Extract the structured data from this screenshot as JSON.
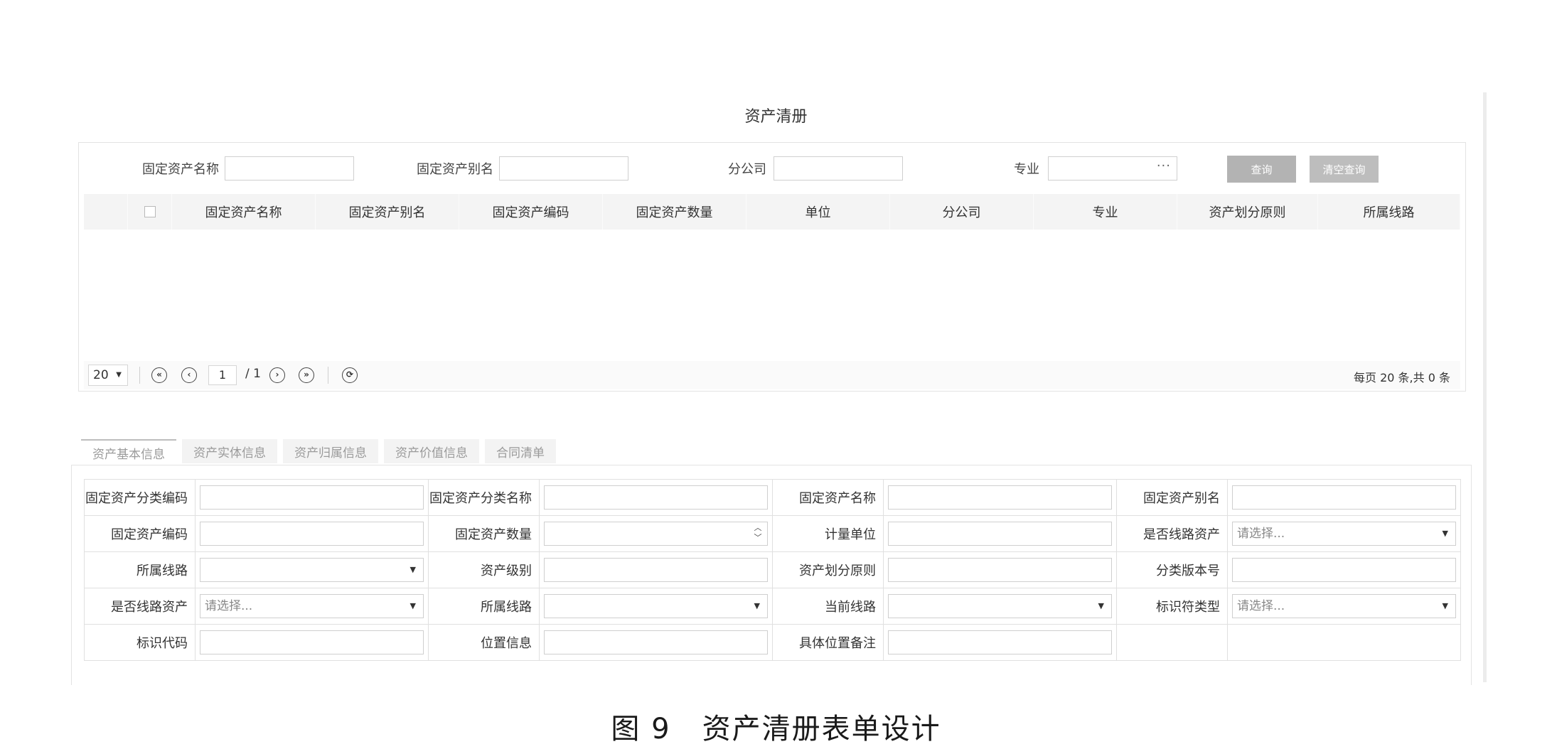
{
  "page": {
    "title": "资产清册"
  },
  "query": {
    "fields": [
      {
        "label": "固定资产名称",
        "value": ""
      },
      {
        "label": "固定资产别名",
        "value": ""
      },
      {
        "label": "分公司",
        "value": ""
      },
      {
        "label": "专业",
        "value": "",
        "ellipsis": "···"
      }
    ],
    "query_button": "查询",
    "clear_button": "清空查询"
  },
  "grid": {
    "columns": [
      "固定资产名称",
      "固定资产别名",
      "固定资产编码",
      "固定资产数量",
      "单位",
      "分公司",
      "专业",
      "资产划分原则",
      "所属线路"
    ],
    "rows": []
  },
  "pager": {
    "page_size": "20",
    "current_page": "1",
    "total_pages": "/ 1",
    "summary": "每页 20 条,共 0 条"
  },
  "tabs": [
    "资产基本信息",
    "资产实体信息",
    "资产归属信息",
    "资产价值信息",
    "合同清单"
  ],
  "form": {
    "rows": [
      [
        {
          "label": "固定资产分类编码",
          "type": "text",
          "value": ""
        },
        {
          "label": "固定资产分类名称",
          "type": "text",
          "value": ""
        },
        {
          "label": "固定资产名称",
          "type": "text",
          "value": ""
        },
        {
          "label": "固定资产别名",
          "type": "text",
          "value": ""
        }
      ],
      [
        {
          "label": "固定资产编码",
          "type": "text",
          "value": ""
        },
        {
          "label": "固定资产数量",
          "type": "number",
          "value": ""
        },
        {
          "label": "计量单位",
          "type": "text",
          "value": ""
        },
        {
          "label": "是否线路资产",
          "type": "select",
          "value": "请选择..."
        }
      ],
      [
        {
          "label": "所属线路",
          "type": "select",
          "value": ""
        },
        {
          "label": "资产级别",
          "type": "text",
          "value": ""
        },
        {
          "label": "资产划分原则",
          "type": "text",
          "value": ""
        },
        {
          "label": "分类版本号",
          "type": "text",
          "value": ""
        }
      ],
      [
        {
          "label": "是否线路资产",
          "type": "select",
          "value": "请选择..."
        },
        {
          "label": "所属线路",
          "type": "select",
          "value": ""
        },
        {
          "label": "当前线路",
          "type": "select",
          "value": ""
        },
        {
          "label": "标识符类型",
          "type": "select",
          "value": "请选择..."
        }
      ],
      [
        {
          "label": "标识代码",
          "type": "text",
          "value": ""
        },
        {
          "label": "位置信息",
          "type": "text",
          "value": ""
        },
        {
          "label": "具体位置备注",
          "type": "text",
          "value": ""
        }
      ]
    ]
  },
  "caption": {
    "figure_number": "图 9",
    "text": "资产清册表单设计"
  },
  "icons": {
    "first_page": "first-page-icon",
    "prev_page": "prev-page-icon",
    "next_page": "next-page-icon",
    "last_page": "last-page-icon",
    "refresh": "refresh-icon",
    "dropdown": "chevron-down-icon",
    "spinner": "spinner-arrows-icon"
  }
}
